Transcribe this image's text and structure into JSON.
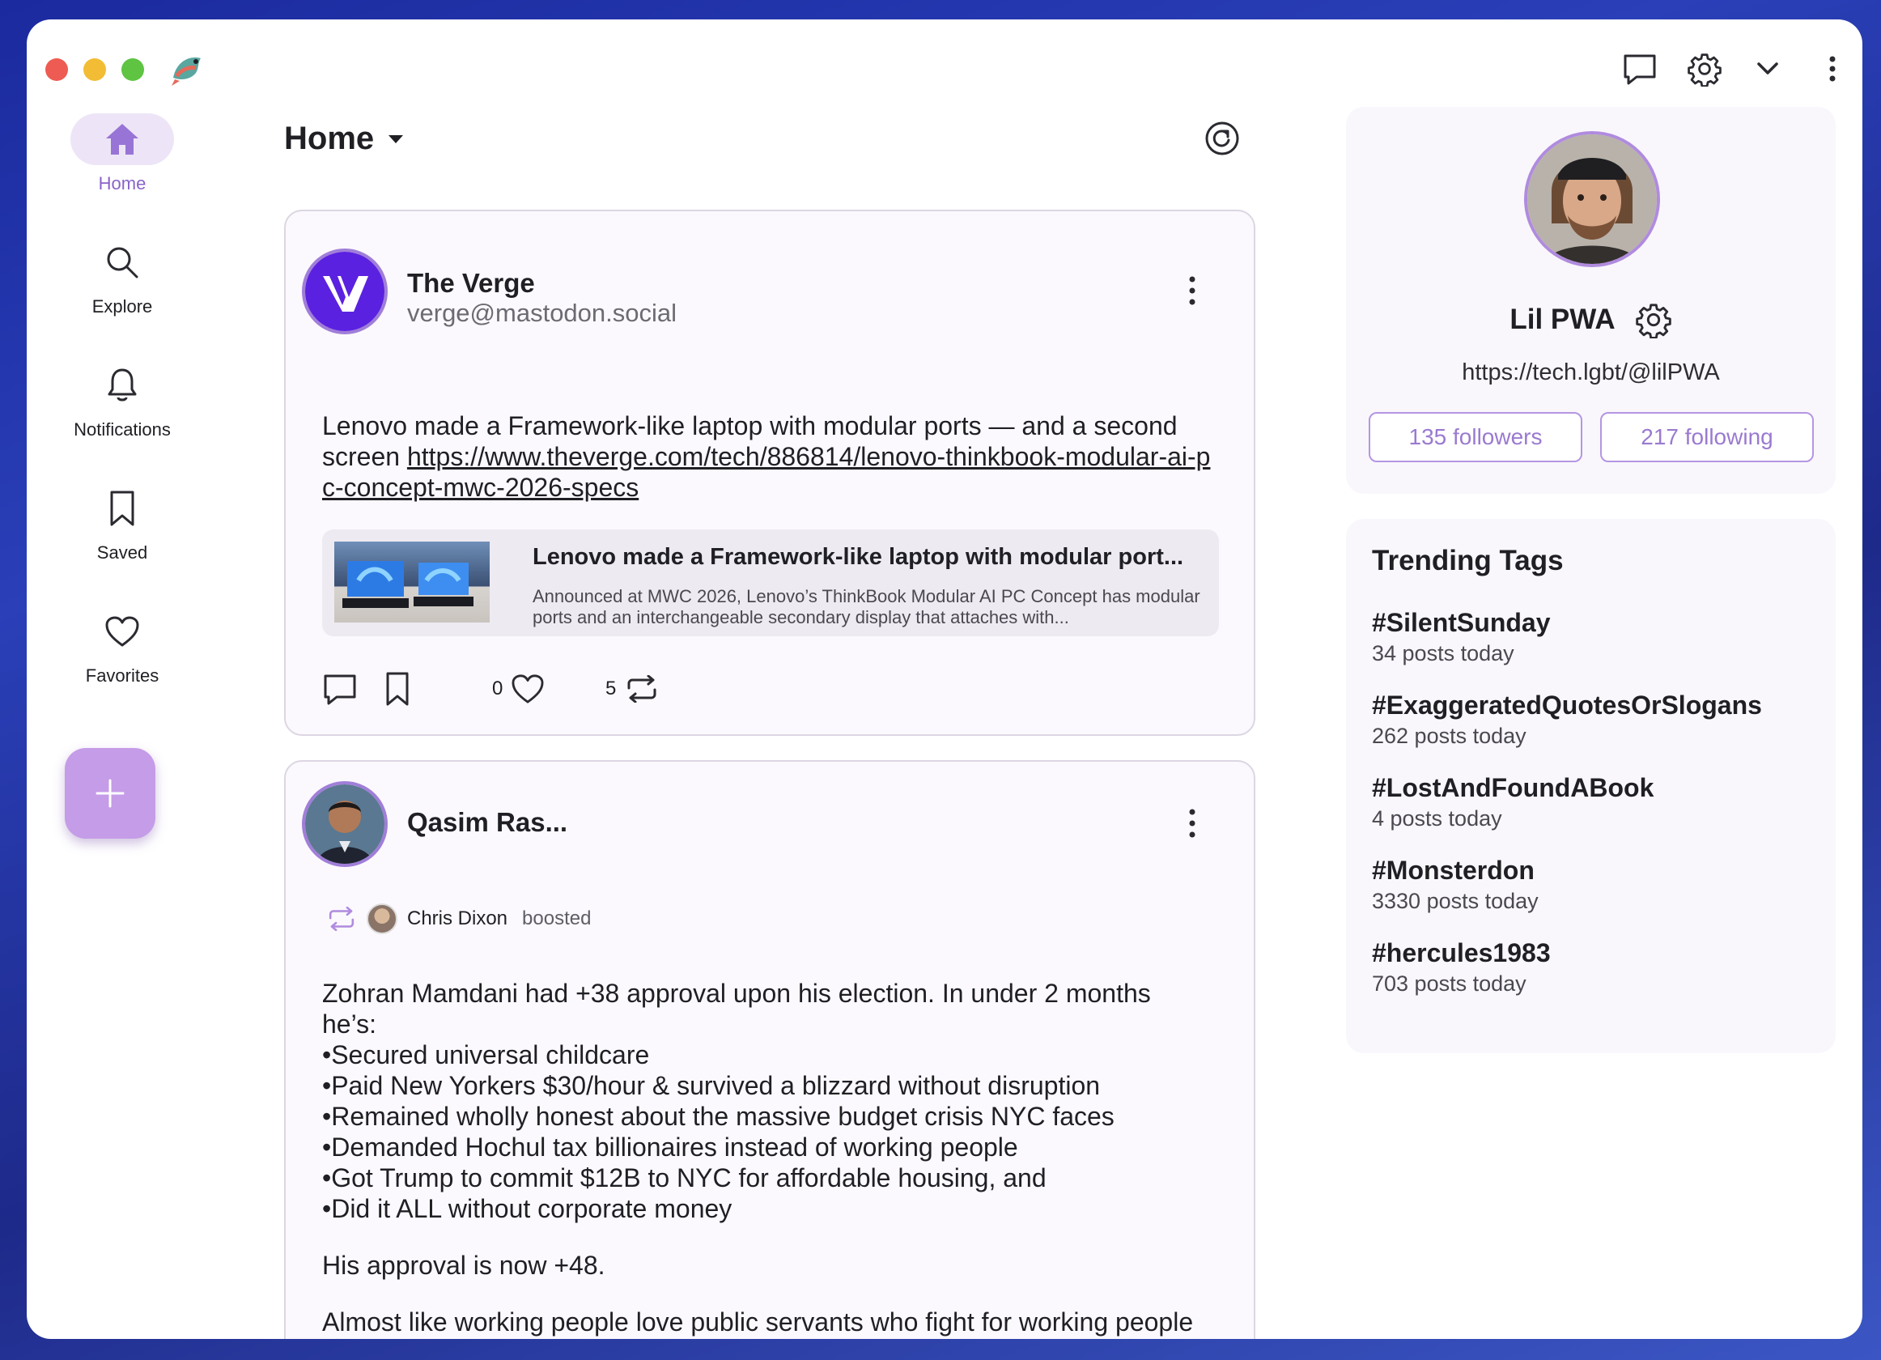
{
  "nav": {
    "items": [
      {
        "label": "Home",
        "icon": "home-icon",
        "active": true
      },
      {
        "label": "Explore",
        "icon": "search-icon"
      },
      {
        "label": "Notifications",
        "icon": "bell-icon"
      },
      {
        "label": "Saved",
        "icon": "bookmark-icon"
      },
      {
        "label": "Favorites",
        "icon": "heart-icon"
      }
    ],
    "compose_icon": "plus-icon"
  },
  "toolbar": {
    "icons": [
      "chat-icon",
      "gear-icon",
      "chevron-down-icon",
      "kebab-menu-icon"
    ]
  },
  "feed": {
    "title": "Home",
    "posts": [
      {
        "author": "The Verge",
        "handle": "verge@mastodon.social",
        "text_prefix": "Lenovo made a Framework-like laptop with modular ports — and a second screen ",
        "link": "https://www.theverge.com/tech/886814/lenovo-thinkbook-modular-ai-pc-concept-mwc-2026-specs",
        "card": {
          "title": "Lenovo made a Framework-like laptop with modular port...",
          "description": "Announced at MWC 2026, Lenovo’s ThinkBook Modular AI PC Concept has modular ports and an interchangeable secondary display that attaches with..."
        },
        "favorites": "0",
        "boosts": "5"
      },
      {
        "author": "Qasim Ras...",
        "boosted_by": "Chris Dixon",
        "boosted_label": "boosted",
        "lines": [
          "Zohran Mamdani had +38 approval upon his election. In under 2 months he’s:",
          "•Secured universal childcare",
          "•Paid New Yorkers $30/hour & survived a blizzard without disruption",
          "•Remained wholly honest about the massive budget crisis NYC faces",
          "•Demanded Hochul tax billionaires instead of working people",
          "•Got Trump to commit $12B to NYC for affordable housing, and",
          "•Did it ALL without corporate money"
        ],
        "para2": "His approval is now +48.",
        "para3": "Almost like working people love public servants who fight for working people 🤯"
      }
    ]
  },
  "profile": {
    "name": "Lil PWA",
    "url": "https://tech.lgbt/@lilPWA",
    "followers": "135 followers",
    "following": "217 following"
  },
  "trending": {
    "title": "Trending Tags",
    "tags": [
      {
        "name": "#SilentSunday",
        "count": "34 posts today"
      },
      {
        "name": "#ExaggeratedQuotesOrSlogans",
        "count": "262 posts today"
      },
      {
        "name": "#LostAndFoundABook",
        "count": "4 posts today"
      },
      {
        "name": "#Monsterdon",
        "count": "3330 posts today"
      },
      {
        "name": "#hercules1983",
        "count": "703 posts today"
      }
    ]
  },
  "colors": {
    "accent": "#8a63c9",
    "fab": "#c59ce8"
  }
}
